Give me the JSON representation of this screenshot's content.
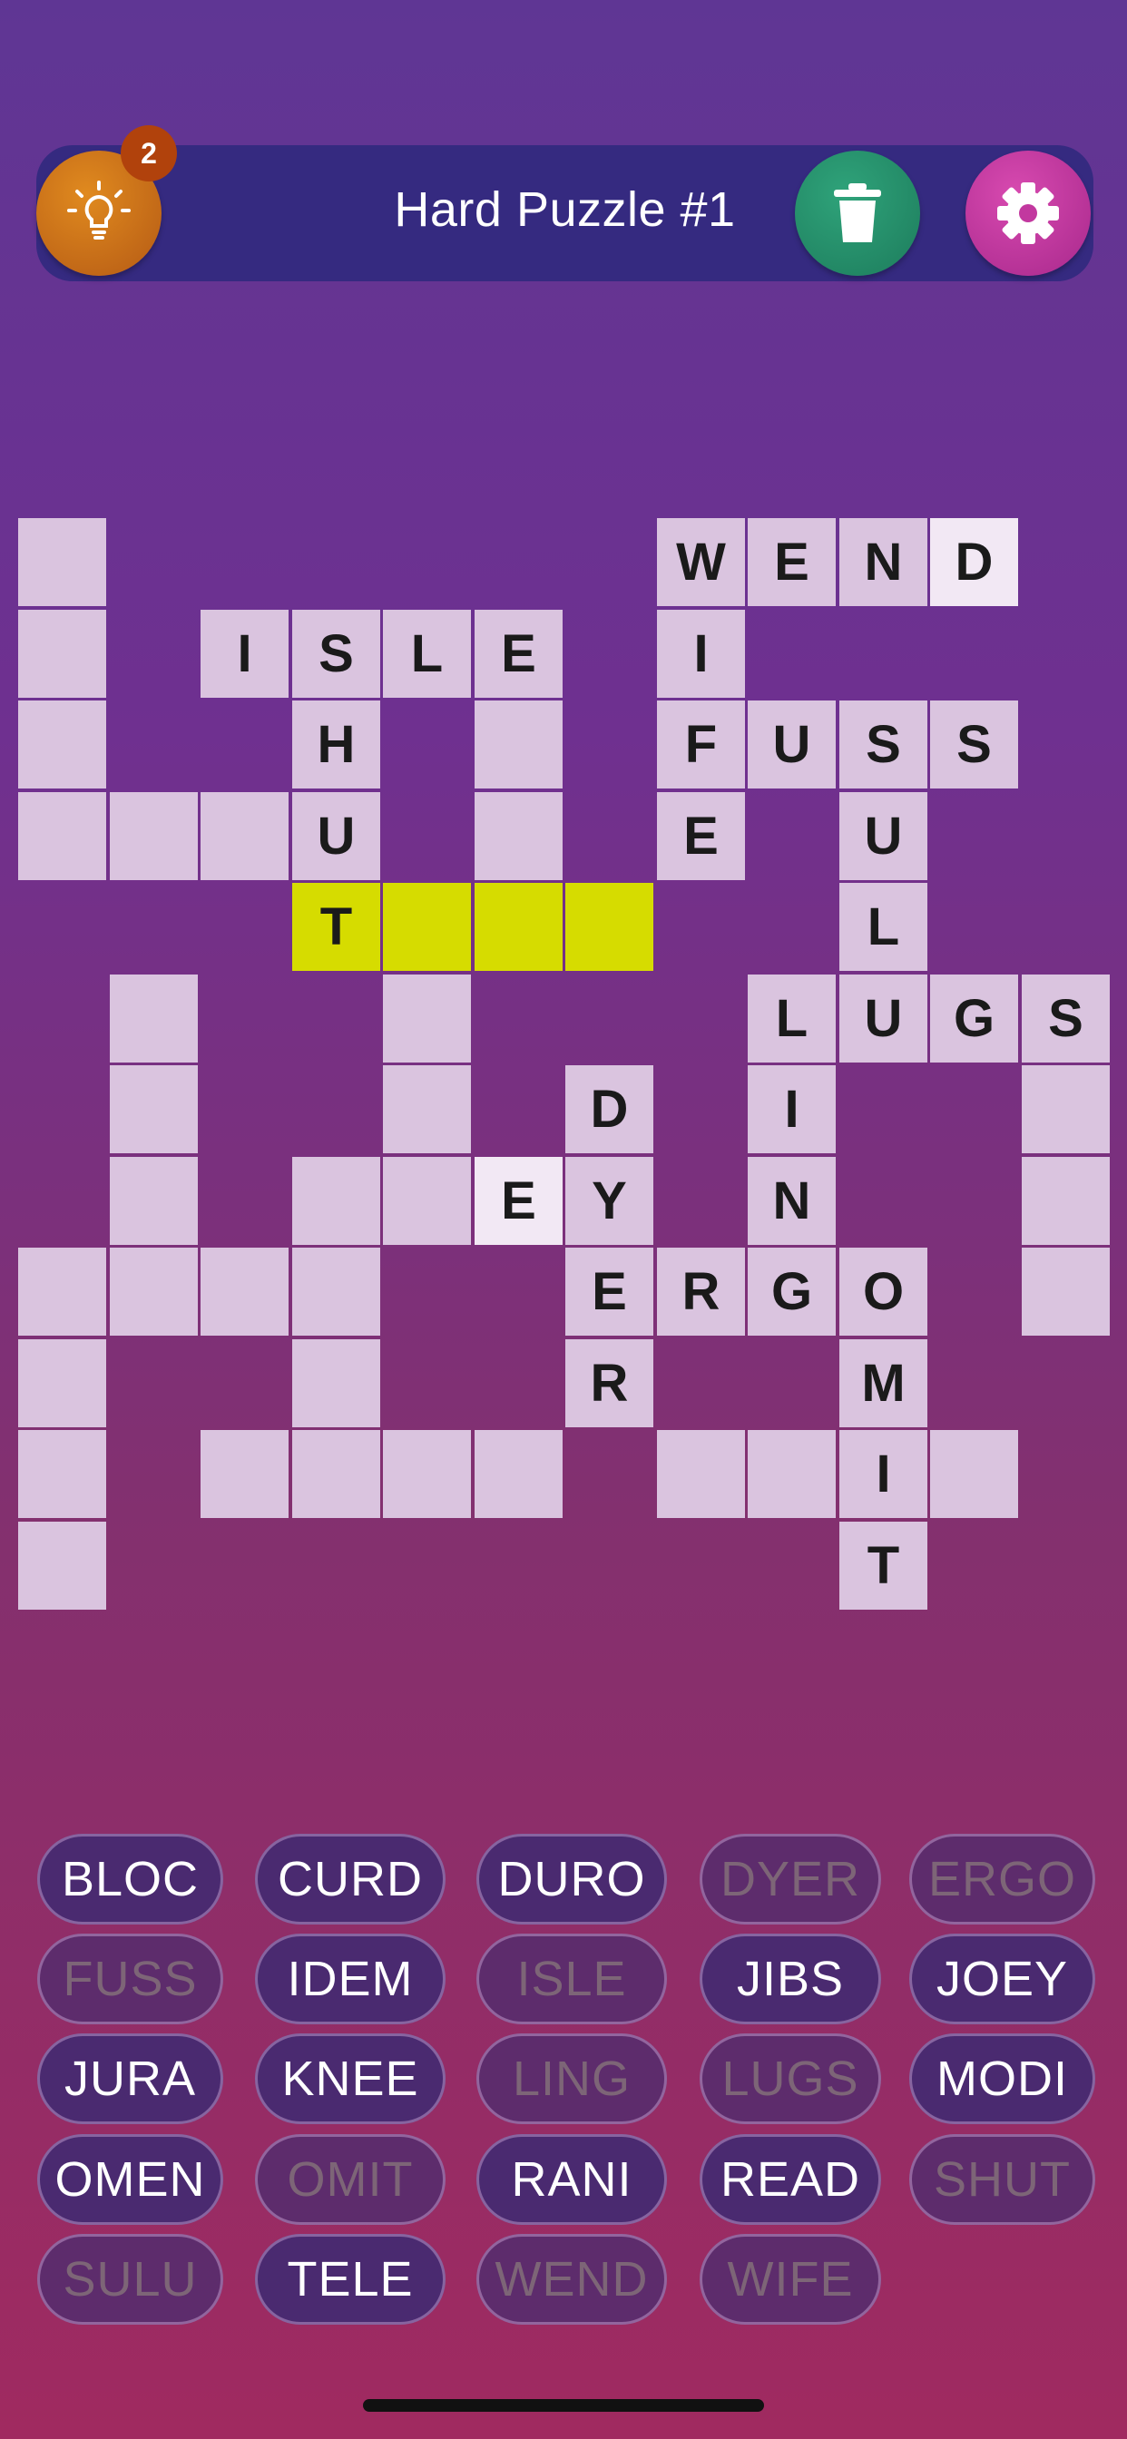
{
  "header": {
    "title": "Hard Puzzle #1",
    "hint_count": "2",
    "hint_icon": "lightbulb-icon",
    "trash_icon": "trash-icon",
    "settings_icon": "gear-icon"
  },
  "colors": {
    "tile": "#dac4df",
    "active_tile": "#d6dc00",
    "highlight_tile": "#f2e8f4",
    "bar": "#352a80",
    "hint_button": "#c8701a",
    "trash_button": "#25916b",
    "settings_button": "#c2389f"
  },
  "grid": {
    "cells": [
      {
        "r": 0,
        "c": 0,
        "l": ""
      },
      {
        "r": 0,
        "c": 7,
        "l": "W"
      },
      {
        "r": 0,
        "c": 8,
        "l": "E"
      },
      {
        "r": 0,
        "c": 9,
        "l": "N"
      },
      {
        "r": 0,
        "c": 10,
        "l": "D",
        "state": "lit"
      },
      {
        "r": 1,
        "c": 0,
        "l": ""
      },
      {
        "r": 1,
        "c": 2,
        "l": "I"
      },
      {
        "r": 1,
        "c": 3,
        "l": "S"
      },
      {
        "r": 1,
        "c": 4,
        "l": "L"
      },
      {
        "r": 1,
        "c": 5,
        "l": "E"
      },
      {
        "r": 1,
        "c": 7,
        "l": "I"
      },
      {
        "r": 2,
        "c": 0,
        "l": ""
      },
      {
        "r": 2,
        "c": 3,
        "l": "H"
      },
      {
        "r": 2,
        "c": 5,
        "l": ""
      },
      {
        "r": 2,
        "c": 7,
        "l": "F"
      },
      {
        "r": 2,
        "c": 8,
        "l": "U"
      },
      {
        "r": 2,
        "c": 9,
        "l": "S"
      },
      {
        "r": 2,
        "c": 10,
        "l": "S"
      },
      {
        "r": 3,
        "c": 0,
        "l": ""
      },
      {
        "r": 3,
        "c": 1,
        "l": ""
      },
      {
        "r": 3,
        "c": 2,
        "l": ""
      },
      {
        "r": 3,
        "c": 3,
        "l": "U"
      },
      {
        "r": 3,
        "c": 5,
        "l": ""
      },
      {
        "r": 3,
        "c": 7,
        "l": "E"
      },
      {
        "r": 3,
        "c": 9,
        "l": "U"
      },
      {
        "r": 4,
        "c": 3,
        "l": "T",
        "state": "active"
      },
      {
        "r": 4,
        "c": 4,
        "l": "",
        "state": "active"
      },
      {
        "r": 4,
        "c": 5,
        "l": "",
        "state": "active"
      },
      {
        "r": 4,
        "c": 6,
        "l": "",
        "state": "active"
      },
      {
        "r": 4,
        "c": 9,
        "l": "L"
      },
      {
        "r": 5,
        "c": 1,
        "l": ""
      },
      {
        "r": 5,
        "c": 4,
        "l": ""
      },
      {
        "r": 5,
        "c": 8,
        "l": "L"
      },
      {
        "r": 5,
        "c": 9,
        "l": "U"
      },
      {
        "r": 5,
        "c": 10,
        "l": "G"
      },
      {
        "r": 5,
        "c": 11,
        "l": "S"
      },
      {
        "r": 6,
        "c": 1,
        "l": ""
      },
      {
        "r": 6,
        "c": 4,
        "l": ""
      },
      {
        "r": 6,
        "c": 6,
        "l": "D"
      },
      {
        "r": 6,
        "c": 8,
        "l": "I"
      },
      {
        "r": 6,
        "c": 11,
        "l": ""
      },
      {
        "r": 7,
        "c": 1,
        "l": ""
      },
      {
        "r": 7,
        "c": 3,
        "l": ""
      },
      {
        "r": 7,
        "c": 4,
        "l": ""
      },
      {
        "r": 7,
        "c": 5,
        "l": "E",
        "state": "lit"
      },
      {
        "r": 7,
        "c": 6,
        "l": "Y"
      },
      {
        "r": 7,
        "c": 8,
        "l": "N"
      },
      {
        "r": 7,
        "c": 11,
        "l": ""
      },
      {
        "r": 8,
        "c": 0,
        "l": ""
      },
      {
        "r": 8,
        "c": 1,
        "l": ""
      },
      {
        "r": 8,
        "c": 2,
        "l": ""
      },
      {
        "r": 8,
        "c": 3,
        "l": ""
      },
      {
        "r": 8,
        "c": 6,
        "l": "E"
      },
      {
        "r": 8,
        "c": 7,
        "l": "R"
      },
      {
        "r": 8,
        "c": 8,
        "l": "G"
      },
      {
        "r": 8,
        "c": 9,
        "l": "O"
      },
      {
        "r": 8,
        "c": 11,
        "l": ""
      },
      {
        "r": 9,
        "c": 0,
        "l": ""
      },
      {
        "r": 9,
        "c": 3,
        "l": ""
      },
      {
        "r": 9,
        "c": 6,
        "l": "R"
      },
      {
        "r": 9,
        "c": 9,
        "l": "M"
      },
      {
        "r": 10,
        "c": 0,
        "l": ""
      },
      {
        "r": 10,
        "c": 2,
        "l": ""
      },
      {
        "r": 10,
        "c": 3,
        "l": ""
      },
      {
        "r": 10,
        "c": 4,
        "l": ""
      },
      {
        "r": 10,
        "c": 5,
        "l": ""
      },
      {
        "r": 10,
        "c": 7,
        "l": ""
      },
      {
        "r": 10,
        "c": 8,
        "l": ""
      },
      {
        "r": 10,
        "c": 9,
        "l": "I"
      },
      {
        "r": 10,
        "c": 10,
        "l": ""
      },
      {
        "r": 11,
        "c": 0,
        "l": ""
      },
      {
        "r": 11,
        "c": 9,
        "l": "T"
      }
    ]
  },
  "word_bank": [
    {
      "word": "BLOC",
      "used": false
    },
    {
      "word": "CURD",
      "used": false
    },
    {
      "word": "DURO",
      "used": false
    },
    {
      "word": "DYER",
      "used": true
    },
    {
      "word": "ERGO",
      "used": true
    },
    {
      "word": "FUSS",
      "used": true
    },
    {
      "word": "IDEM",
      "used": false
    },
    {
      "word": "ISLE",
      "used": true
    },
    {
      "word": "JIBS",
      "used": false
    },
    {
      "word": "JOEY",
      "used": false
    },
    {
      "word": "JURA",
      "used": false
    },
    {
      "word": "KNEE",
      "used": false
    },
    {
      "word": "LING",
      "used": true
    },
    {
      "word": "LUGS",
      "used": true
    },
    {
      "word": "MODI",
      "used": false
    },
    {
      "word": "OMEN",
      "used": false
    },
    {
      "word": "OMIT",
      "used": true
    },
    {
      "word": "RANI",
      "used": false
    },
    {
      "word": "READ",
      "used": false
    },
    {
      "word": "SHUT",
      "used": true
    },
    {
      "word": "SULU",
      "used": true
    },
    {
      "word": "TELE",
      "used": false
    },
    {
      "word": "WEND",
      "used": true
    },
    {
      "word": "WIFE",
      "used": true
    }
  ]
}
